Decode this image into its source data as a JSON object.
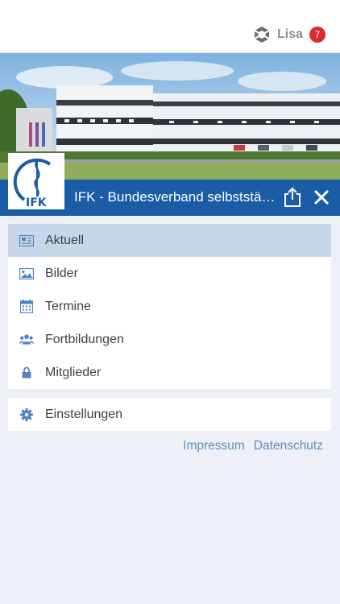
{
  "header": {
    "user_name": "Lisa",
    "notification_count": "7",
    "app_icon": "hive-logo-icon"
  },
  "banner": {
    "logo_text": "IFK",
    "title": "IFK - Bundesverband selbstständiger Physiotherapeuten",
    "share_icon": "share-icon",
    "close_icon": "close-icon",
    "accent_color": "#1a5da6"
  },
  "menu": {
    "items": [
      {
        "label": "Aktuell",
        "icon": "newspaper-icon",
        "active": true
      },
      {
        "label": "Bilder",
        "icon": "image-icon",
        "active": false
      },
      {
        "label": "Termine",
        "icon": "calendar-icon",
        "active": false
      },
      {
        "label": "Fortbildungen",
        "icon": "users-icon",
        "active": false
      },
      {
        "label": "Mitglieder",
        "icon": "lock-icon",
        "active": false
      }
    ]
  },
  "settings": {
    "label": "Einstellungen",
    "icon": "gear-icon"
  },
  "footer": {
    "impressum": "Impressum",
    "datenschutz": "Datenschutz"
  }
}
